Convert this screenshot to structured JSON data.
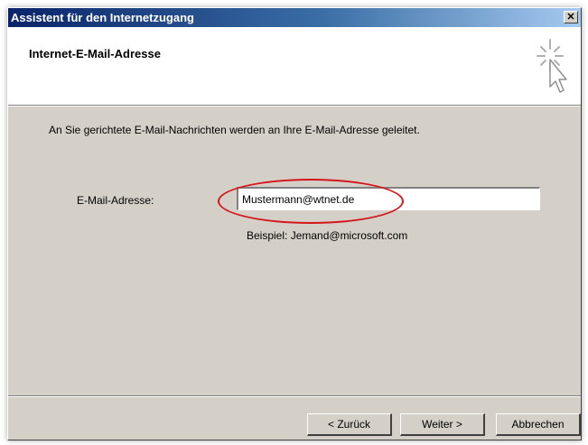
{
  "window": {
    "title": "Assistent für den Internetzugang",
    "close_glyph": "✕"
  },
  "header": {
    "title": "Internet-E-Mail-Adresse",
    "icon": "wizard-cursor-icon"
  },
  "body": {
    "intro_text": "An Sie gerichtete E-Mail-Nachrichten werden an Ihre E-Mail-Adresse geleitet.",
    "email_label": "E-Mail-Adresse:",
    "email_value": "Mustermann@wtnet.de",
    "example_text": "Beispiel: Jemand@microsoft.com"
  },
  "buttons": {
    "back_label": "< Zurück",
    "next_label": "Weiter >",
    "cancel_label": "Abbrechen"
  },
  "colors": {
    "dialog_face": "#d4d0c8",
    "titlebar_start": "#0a246a",
    "titlebar_end": "#a6caf0",
    "highlight_ellipse": "#d4161c"
  }
}
